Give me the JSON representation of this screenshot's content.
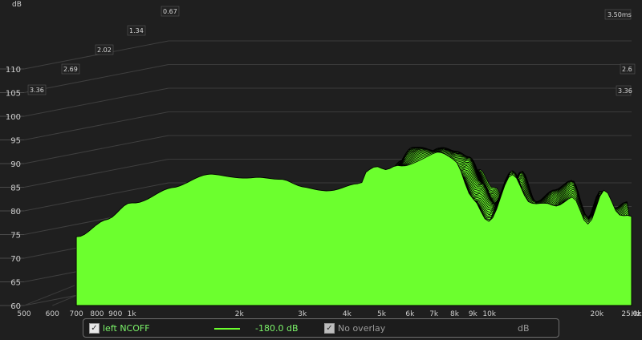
{
  "chart_data": {
    "type": "waterfall",
    "y_unit": "dB",
    "yticks": [
      "60",
      "65",
      "70",
      "75",
      "80",
      "85",
      "90",
      "95",
      "100",
      "105",
      "110"
    ],
    "ylim": [
      60,
      110
    ],
    "x_unit": "Hz",
    "xscale": "log",
    "xlim": [
      500,
      25000
    ],
    "xticks": [
      {
        "v": 500,
        "label": "500"
      },
      {
        "v": 600,
        "label": "600"
      },
      {
        "v": 700,
        "label": "700"
      },
      {
        "v": 800,
        "label": "800"
      },
      {
        "v": 900,
        "label": "900"
      },
      {
        "v": 1000,
        "label": "1k"
      },
      {
        "v": 2000,
        "label": "2k"
      },
      {
        "v": 3000,
        "label": "3k"
      },
      {
        "v": 4000,
        "label": "4k"
      },
      {
        "v": 5000,
        "label": "5k"
      },
      {
        "v": 6000,
        "label": "6k"
      },
      {
        "v": 7000,
        "label": "7k"
      },
      {
        "v": 8000,
        "label": "8k"
      },
      {
        "v": 9000,
        "label": "9k"
      },
      {
        "v": 10000,
        "label": "10k"
      },
      {
        "v": 20000,
        "label": "20k"
      },
      {
        "v": 25000,
        "label": "25.0k"
      }
    ],
    "time_ticks": [
      "3.36",
      "2.69",
      "2.02",
      "1.34",
      "0.67"
    ],
    "time_end_label": "3.50ms",
    "right_markers": [
      "2.6",
      "3.36"
    ],
    "slices": 40,
    "series": [
      {
        "name": "left NCOFF",
        "fill_color": "#6cff2e",
        "line_color": "#000000",
        "anchors": [
          {
            "f": 700,
            "db": 74.9
          },
          {
            "f": 850,
            "db": 78.0
          },
          {
            "f": 1000,
            "db": 81.4
          },
          {
            "f": 1300,
            "db": 85.2
          },
          {
            "f": 1700,
            "db": 87.5
          },
          {
            "f": 2200,
            "db": 87.3
          },
          {
            "f": 2600,
            "db": 86.3
          },
          {
            "f": 3000,
            "db": 85.1
          },
          {
            "f": 3600,
            "db": 84.6
          },
          {
            "f": 4300,
            "db": 85.4
          },
          {
            "f": 5000,
            "db": 88.8
          },
          {
            "f": 5600,
            "db": 91.5
          },
          {
            "f": 6000,
            "db": 91.5
          },
          {
            "f": 7000,
            "db": 90.7
          },
          {
            "f": 8000,
            "db": 89.5
          },
          {
            "f": 9000,
            "db": 84.0
          },
          {
            "f": 10000,
            "db": 79.6
          },
          {
            "f": 11500,
            "db": 86.5
          },
          {
            "f": 13000,
            "db": 80.0
          },
          {
            "f": 15000,
            "db": 82.5
          },
          {
            "f": 17000,
            "db": 84.5
          },
          {
            "f": 19000,
            "db": 76.5
          },
          {
            "f": 21000,
            "db": 82.4
          },
          {
            "f": 23000,
            "db": 78.5
          },
          {
            "f": 25000,
            "db": 80.0
          }
        ]
      }
    ],
    "legend": {
      "checkbox_mark": "✓",
      "series_label": "left NCOFF",
      "floor_value": "-180.0 dB",
      "overlay_label": "No overlay",
      "unit": "dB"
    }
  }
}
